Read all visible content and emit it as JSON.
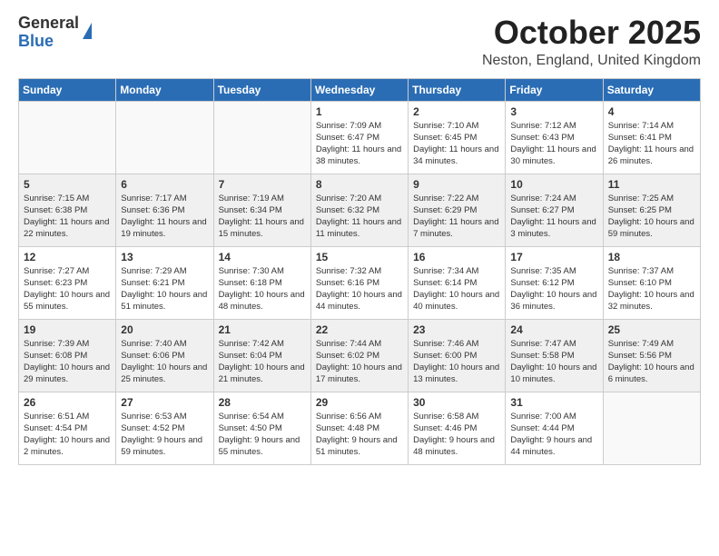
{
  "logo": {
    "line1": "General",
    "line2": "Blue"
  },
  "header": {
    "month": "October 2025",
    "location": "Neston, England, United Kingdom"
  },
  "weekdays": [
    "Sunday",
    "Monday",
    "Tuesday",
    "Wednesday",
    "Thursday",
    "Friday",
    "Saturday"
  ],
  "weeks": [
    [
      {
        "day": "",
        "info": ""
      },
      {
        "day": "",
        "info": ""
      },
      {
        "day": "",
        "info": ""
      },
      {
        "day": "1",
        "info": "Sunrise: 7:09 AM\nSunset: 6:47 PM\nDaylight: 11 hours\nand 38 minutes."
      },
      {
        "day": "2",
        "info": "Sunrise: 7:10 AM\nSunset: 6:45 PM\nDaylight: 11 hours\nand 34 minutes."
      },
      {
        "day": "3",
        "info": "Sunrise: 7:12 AM\nSunset: 6:43 PM\nDaylight: 11 hours\nand 30 minutes."
      },
      {
        "day": "4",
        "info": "Sunrise: 7:14 AM\nSunset: 6:41 PM\nDaylight: 11 hours\nand 26 minutes."
      }
    ],
    [
      {
        "day": "5",
        "info": "Sunrise: 7:15 AM\nSunset: 6:38 PM\nDaylight: 11 hours\nand 22 minutes."
      },
      {
        "day": "6",
        "info": "Sunrise: 7:17 AM\nSunset: 6:36 PM\nDaylight: 11 hours\nand 19 minutes."
      },
      {
        "day": "7",
        "info": "Sunrise: 7:19 AM\nSunset: 6:34 PM\nDaylight: 11 hours\nand 15 minutes."
      },
      {
        "day": "8",
        "info": "Sunrise: 7:20 AM\nSunset: 6:32 PM\nDaylight: 11 hours\nand 11 minutes."
      },
      {
        "day": "9",
        "info": "Sunrise: 7:22 AM\nSunset: 6:29 PM\nDaylight: 11 hours\nand 7 minutes."
      },
      {
        "day": "10",
        "info": "Sunrise: 7:24 AM\nSunset: 6:27 PM\nDaylight: 11 hours\nand 3 minutes."
      },
      {
        "day": "11",
        "info": "Sunrise: 7:25 AM\nSunset: 6:25 PM\nDaylight: 10 hours\nand 59 minutes."
      }
    ],
    [
      {
        "day": "12",
        "info": "Sunrise: 7:27 AM\nSunset: 6:23 PM\nDaylight: 10 hours\nand 55 minutes."
      },
      {
        "day": "13",
        "info": "Sunrise: 7:29 AM\nSunset: 6:21 PM\nDaylight: 10 hours\nand 51 minutes."
      },
      {
        "day": "14",
        "info": "Sunrise: 7:30 AM\nSunset: 6:18 PM\nDaylight: 10 hours\nand 48 minutes."
      },
      {
        "day": "15",
        "info": "Sunrise: 7:32 AM\nSunset: 6:16 PM\nDaylight: 10 hours\nand 44 minutes."
      },
      {
        "day": "16",
        "info": "Sunrise: 7:34 AM\nSunset: 6:14 PM\nDaylight: 10 hours\nand 40 minutes."
      },
      {
        "day": "17",
        "info": "Sunrise: 7:35 AM\nSunset: 6:12 PM\nDaylight: 10 hours\nand 36 minutes."
      },
      {
        "day": "18",
        "info": "Sunrise: 7:37 AM\nSunset: 6:10 PM\nDaylight: 10 hours\nand 32 minutes."
      }
    ],
    [
      {
        "day": "19",
        "info": "Sunrise: 7:39 AM\nSunset: 6:08 PM\nDaylight: 10 hours\nand 29 minutes."
      },
      {
        "day": "20",
        "info": "Sunrise: 7:40 AM\nSunset: 6:06 PM\nDaylight: 10 hours\nand 25 minutes."
      },
      {
        "day": "21",
        "info": "Sunrise: 7:42 AM\nSunset: 6:04 PM\nDaylight: 10 hours\nand 21 minutes."
      },
      {
        "day": "22",
        "info": "Sunrise: 7:44 AM\nSunset: 6:02 PM\nDaylight: 10 hours\nand 17 minutes."
      },
      {
        "day": "23",
        "info": "Sunrise: 7:46 AM\nSunset: 6:00 PM\nDaylight: 10 hours\nand 13 minutes."
      },
      {
        "day": "24",
        "info": "Sunrise: 7:47 AM\nSunset: 5:58 PM\nDaylight: 10 hours\nand 10 minutes."
      },
      {
        "day": "25",
        "info": "Sunrise: 7:49 AM\nSunset: 5:56 PM\nDaylight: 10 hours\nand 6 minutes."
      }
    ],
    [
      {
        "day": "26",
        "info": "Sunrise: 6:51 AM\nSunset: 4:54 PM\nDaylight: 10 hours\nand 2 minutes."
      },
      {
        "day": "27",
        "info": "Sunrise: 6:53 AM\nSunset: 4:52 PM\nDaylight: 9 hours\nand 59 minutes."
      },
      {
        "day": "28",
        "info": "Sunrise: 6:54 AM\nSunset: 4:50 PM\nDaylight: 9 hours\nand 55 minutes."
      },
      {
        "day": "29",
        "info": "Sunrise: 6:56 AM\nSunset: 4:48 PM\nDaylight: 9 hours\nand 51 minutes."
      },
      {
        "day": "30",
        "info": "Sunrise: 6:58 AM\nSunset: 4:46 PM\nDaylight: 9 hours\nand 48 minutes."
      },
      {
        "day": "31",
        "info": "Sunrise: 7:00 AM\nSunset: 4:44 PM\nDaylight: 9 hours\nand 44 minutes."
      },
      {
        "day": "",
        "info": ""
      }
    ]
  ]
}
